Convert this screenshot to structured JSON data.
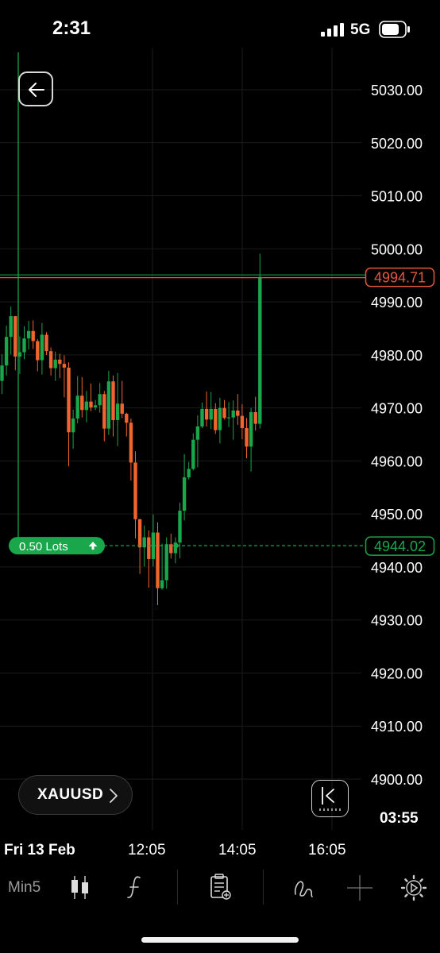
{
  "status_bar": {
    "time": "2:31",
    "network": "5G"
  },
  "chart_data": {
    "type": "candlestick",
    "symbol": "XAUUSD",
    "timeframe": "Min5",
    "ylim": [
      4894,
      5040
    ],
    "y_ticks": [
      5030,
      5020,
      5010,
      5000,
      4990,
      4980,
      4970,
      4960,
      4950,
      4940,
      4930,
      4920,
      4910,
      4900
    ],
    "y_tick_labels": [
      "5030.00",
      "5020.00",
      "5010.00",
      "5000.00",
      "4990.00",
      "4980.00",
      "4970.00",
      "4960.00",
      "4950.00",
      "4940.00",
      "4930.00",
      "4920.00",
      "4910.00",
      "4900.00"
    ],
    "x_labels": [
      "Fri 13 Feb",
      "12:05",
      "14:05",
      "16:05"
    ],
    "colors": {
      "up": "#1aa64a",
      "down": "#f0642e",
      "bid_line": "#e2583c",
      "position_line": "#1aa64a",
      "grid": "#1b1b1b"
    },
    "current_price": {
      "label": "4994.71",
      "value": 4994.71
    },
    "position": {
      "entry_label": "4944.02",
      "entry_value": 4944.02,
      "lots_label": "0.50 Lots"
    },
    "ohlc": [
      [
        4975.1,
        4980.1,
        4972.6,
        4978.0
      ],
      [
        4978.0,
        4985.5,
        4976.1,
        4983.4
      ],
      [
        4983.4,
        4989.1,
        4980.1,
        4987.3
      ],
      [
        4987.3,
        4987.3,
        4977.1,
        4979.7
      ],
      [
        4979.7,
        4983.5,
        4976.4,
        4980.5
      ],
      [
        4980.5,
        4985.4,
        4979.2,
        4983.1
      ],
      [
        4983.1,
        4986.4,
        4981.0,
        4984.5
      ],
      [
        4984.5,
        4986.5,
        4981.1,
        4982.6
      ],
      [
        4982.6,
        4983.0,
        4976.9,
        4979.0
      ],
      [
        4979.0,
        4986.0,
        4976.3,
        4983.8
      ],
      [
        4983.8,
        4984.3,
        4980.0,
        4980.7
      ],
      [
        4980.7,
        4981.4,
        4976.1,
        4977.5
      ],
      [
        4977.5,
        4980.6,
        4975.1,
        4979.1
      ],
      [
        4979.1,
        4980.2,
        4975.6,
        4978.3
      ],
      [
        4978.3,
        4979.9,
        4972.0,
        4977.6
      ],
      [
        4977.6,
        4978.6,
        4959.0,
        4965.4
      ],
      [
        4965.4,
        4969.7,
        4962.3,
        4968.0
      ],
      [
        4968.0,
        4976.0,
        4967.1,
        4972.3
      ],
      [
        4972.3,
        4975.8,
        4968.2,
        4969.6
      ],
      [
        4969.6,
        4973.2,
        4967.3,
        4971.2
      ],
      [
        4971.2,
        4974.6,
        4969.4,
        4970.1
      ],
      [
        4970.1,
        4971.5,
        4969.6,
        4970.5
      ],
      [
        4970.5,
        4974.7,
        4969.1,
        4972.6
      ],
      [
        4972.6,
        4973.2,
        4963.7,
        4966.1
      ],
      [
        4966.1,
        4977.0,
        4964.9,
        4975.0
      ],
      [
        4975.0,
        4976.1,
        4964.6,
        4967.7
      ],
      [
        4967.7,
        4976.6,
        4962.8,
        4970.8
      ],
      [
        4970.8,
        4975.1,
        4968.1,
        4968.9
      ],
      [
        4968.9,
        4969.1,
        4964.6,
        4967.2
      ],
      [
        4967.2,
        4968.0,
        4956.3,
        4959.7
      ],
      [
        4959.7,
        4961.8,
        4945.4,
        4949.0
      ],
      [
        4949.0,
        4949.1,
        4938.7,
        4943.7
      ],
      [
        4943.7,
        4947.8,
        4940.1,
        4945.6
      ],
      [
        4945.6,
        4946.9,
        4936.1,
        4941.5
      ],
      [
        4941.5,
        4949.9,
        4940.1,
        4946.5
      ],
      [
        4946.5,
        4948.4,
        4932.8,
        4936.0
      ],
      [
        4936.0,
        4944.4,
        4935.7,
        4937.5
      ],
      [
        4937.5,
        4945.6,
        4935.9,
        4944.3
      ],
      [
        4944.3,
        4946.3,
        4941.6,
        4942.6
      ],
      [
        4942.6,
        4945.6,
        4940.7,
        4944.6
      ],
      [
        4944.6,
        4952.1,
        4941.7,
        4950.6
      ],
      [
        4950.6,
        4961.3,
        4948.8,
        4956.9
      ],
      [
        4956.9,
        4959.8,
        4956.5,
        4958.5
      ],
      [
        4958.5,
        4965.2,
        4958.2,
        4964.0
      ],
      [
        4964.0,
        4968.6,
        4958.8,
        4966.5
      ],
      [
        4966.5,
        4971.0,
        4966.2,
        4969.8
      ],
      [
        4969.8,
        4973.1,
        4966.5,
        4967.8
      ],
      [
        4967.8,
        4973.0,
        4966.0,
        4969.8
      ],
      [
        4969.8,
        4970.9,
        4965.1,
        4965.8
      ],
      [
        4965.8,
        4971.9,
        4963.3,
        4970.0
      ],
      [
        4970.0,
        4971.5,
        4967.8,
        4968.1
      ],
      [
        4968.1,
        4971.1,
        4966.4,
        4968.2
      ],
      [
        4968.2,
        4971.4,
        4964.0,
        4969.5
      ],
      [
        4969.5,
        4972.6,
        4966.8,
        4968.5
      ],
      [
        4968.5,
        4970.7,
        4964.1,
        4966.2
      ],
      [
        4966.2,
        4968.1,
        4960.5,
        4962.7
      ],
      [
        4962.7,
        4970.0,
        4958.0,
        4969.2
      ],
      [
        4969.2,
        4972.1,
        4965.7,
        4967.0
      ],
      [
        4967.0,
        4999.1,
        4966.1,
        4994.7
      ]
    ]
  },
  "controls": {
    "symbol": "XAUUSD",
    "countdown": "03:55"
  },
  "toolbar": {
    "timeframe": "Min5"
  }
}
